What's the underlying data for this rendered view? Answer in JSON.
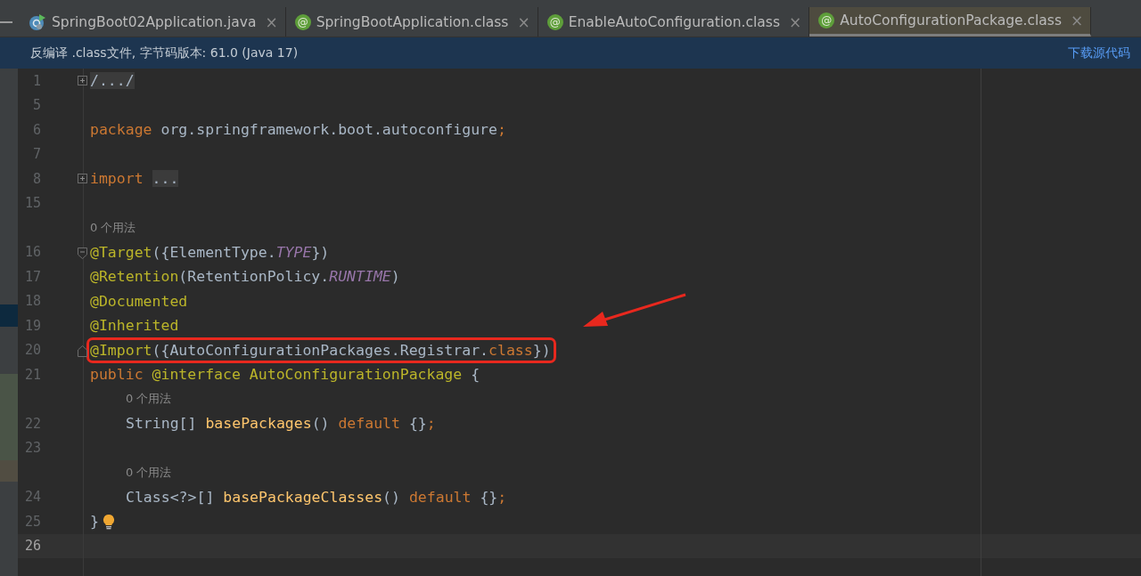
{
  "tabs": [
    {
      "label": "SpringBoot02Application.java",
      "kind": "java",
      "close": "×",
      "selected": false
    },
    {
      "label": "SpringBootApplication.class",
      "kind": "annotation",
      "icon_text": "@",
      "close": "×",
      "selected": false
    },
    {
      "label": "EnableAutoConfiguration.class",
      "kind": "annotation",
      "icon_text": "@",
      "close": "×",
      "selected": false
    },
    {
      "label": "AutoConfigurationPackage.class",
      "kind": "annotation",
      "icon_text": "@",
      "close": "×",
      "selected": true
    }
  ],
  "banner": {
    "text": "反编译 .class文件, 字节码版本: 61.0 (Java 17)",
    "link": "下载源代码"
  },
  "lines": [
    {
      "kind": "code",
      "number": "1",
      "fold": {
        "kind": "collapsed"
      },
      "tokens": [
        {
          "text": "/.../",
          "kind": "folded"
        }
      ]
    },
    {
      "kind": "code",
      "number": "5"
    },
    {
      "kind": "code",
      "number": "6",
      "tokens": [
        {
          "text": "package ",
          "kind": "keyword"
        },
        {
          "text": "org.springframework.boot.autoconfigure",
          "kind": "plain"
        },
        {
          "text": ";",
          "kind": "keyword"
        }
      ]
    },
    {
      "kind": "code",
      "number": "7"
    },
    {
      "kind": "code",
      "number": "8",
      "fold": {
        "kind": "collapsed"
      },
      "tokens": [
        {
          "text": "import ",
          "kind": "keyword"
        },
        {
          "text": "...",
          "kind": "folded"
        }
      ]
    },
    {
      "kind": "code",
      "number": "15"
    },
    {
      "kind": "hint",
      "text": "0 个用法"
    },
    {
      "kind": "code",
      "number": "16",
      "fold": {
        "kind": "start"
      },
      "tokens": [
        {
          "text": "@Target",
          "kind": "annotation"
        },
        {
          "text": "({ElementType.",
          "kind": "plain"
        },
        {
          "text": "TYPE",
          "kind": "constant"
        },
        {
          "text": "})",
          "kind": "plain"
        }
      ]
    },
    {
      "kind": "code",
      "number": "17",
      "tokens": [
        {
          "text": "@Retention",
          "kind": "annotation"
        },
        {
          "text": "(RetentionPolicy.",
          "kind": "plain"
        },
        {
          "text": "RUNTIME",
          "kind": "constant"
        },
        {
          "text": ")",
          "kind": "plain"
        }
      ]
    },
    {
      "kind": "code",
      "number": "18",
      "tokens": [
        {
          "text": "@Documented",
          "kind": "annotation"
        }
      ]
    },
    {
      "kind": "code",
      "number": "19",
      "tokens": [
        {
          "text": "@Inherited",
          "kind": "annotation"
        }
      ]
    },
    {
      "kind": "code",
      "number": "20",
      "fold": {
        "kind": "end"
      },
      "highlighted": true,
      "tokens": [
        {
          "text": "@Import",
          "kind": "annotation"
        },
        {
          "text": "({AutoConfigurationPackages.Registrar.",
          "kind": "plain"
        },
        {
          "text": "class",
          "kind": "keyword"
        },
        {
          "text": "})",
          "kind": "plain"
        }
      ]
    },
    {
      "kind": "code",
      "number": "21",
      "tokens": [
        {
          "text": "public ",
          "kind": "keyword"
        },
        {
          "text": "@interface ",
          "kind": "annotation"
        },
        {
          "text": "AutoConfigurationPackage",
          "kind": "annotation"
        },
        {
          "text": " {",
          "kind": "plain"
        }
      ],
      "children": [
        {
          "kind": "hint",
          "text": "0 个用法"
        },
        {
          "kind": "code",
          "number": "22",
          "tokens": [
            {
              "text": "String[] ",
              "kind": "plain"
            },
            {
              "text": "basePackages",
              "kind": "method"
            },
            {
              "text": "() ",
              "kind": "plain"
            },
            {
              "text": "default ",
              "kind": "keyword"
            },
            {
              "text": "{}",
              "kind": "plain"
            },
            {
              "text": ";",
              "kind": "keyword"
            }
          ]
        },
        {
          "kind": "code",
          "number": "23"
        },
        {
          "kind": "hint",
          "text": "0 个用法"
        },
        {
          "kind": "code",
          "number": "24",
          "tokens": [
            {
              "text": "Class<?>[] ",
              "kind": "plain"
            },
            {
              "text": "basePackageClasses",
              "kind": "method"
            },
            {
              "text": "() ",
              "kind": "plain"
            },
            {
              "text": "default ",
              "kind": "keyword"
            },
            {
              "text": "{}",
              "kind": "plain"
            },
            {
              "text": ";",
              "kind": "keyword"
            }
          ]
        }
      ]
    },
    {
      "kind": "code",
      "number": "25",
      "bulb": true,
      "tokens": [
        {
          "text": "}",
          "kind": "plain"
        }
      ]
    },
    {
      "kind": "code",
      "number": "26",
      "current": true
    }
  ]
}
